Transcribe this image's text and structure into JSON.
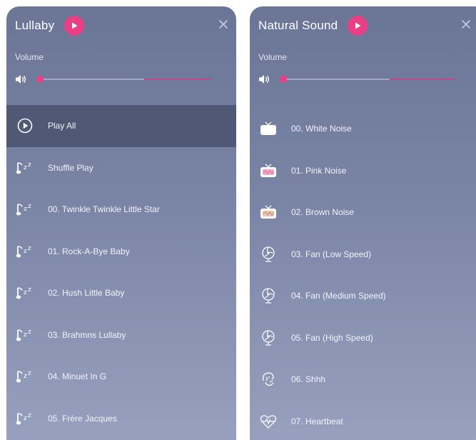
{
  "lullaby": {
    "title": "Lullaby",
    "volume_label": "Volume",
    "volume_level": 0.0,
    "items": [
      {
        "label": "Play All",
        "icon": "play-circle-icon",
        "active": true
      },
      {
        "label": "Shuffle Play",
        "icon": "music-note-zz-icon"
      },
      {
        "label": "00. Twinkle Twinkle Little Star",
        "icon": "music-note-zz-icon"
      },
      {
        "label": "01. Rock-A-Bye Baby",
        "icon": "music-note-zz-icon"
      },
      {
        "label": "02. Hush Little Baby",
        "icon": "music-note-zz-icon"
      },
      {
        "label": "03. Brahmns Lullaby",
        "icon": "music-note-zz-icon"
      },
      {
        "label": "04. Minuet In G",
        "icon": "music-note-zz-icon"
      },
      {
        "label": "05. Frère Jacques",
        "icon": "music-note-zz-icon"
      }
    ]
  },
  "natural": {
    "title": "Natural Sound",
    "volume_label": "Volume",
    "volume_level": 0.0,
    "items": [
      {
        "label": "00. White Noise",
        "icon": "tv-icon"
      },
      {
        "label": "01. Pink Noise",
        "icon": "tv-pink-icon"
      },
      {
        "label": "02. Brown Noise",
        "icon": "tv-brown-icon"
      },
      {
        "label": "03. Fan (Low Speed)",
        "icon": "fan-icon"
      },
      {
        "label": "04. Fan (Medium Speed)",
        "icon": "fan-icon"
      },
      {
        "label": "05. Fan (High Speed)",
        "icon": "fan-icon"
      },
      {
        "label": "06. Shhh",
        "icon": "shush-face-icon"
      },
      {
        "label": "07. Heartbeat",
        "icon": "heartbeat-icon"
      }
    ]
  },
  "colors": {
    "accent": "#ea3f84",
    "panel_top": "#6b7596",
    "panel_bottom": "#97a0be",
    "active_row": "#4f5874"
  }
}
